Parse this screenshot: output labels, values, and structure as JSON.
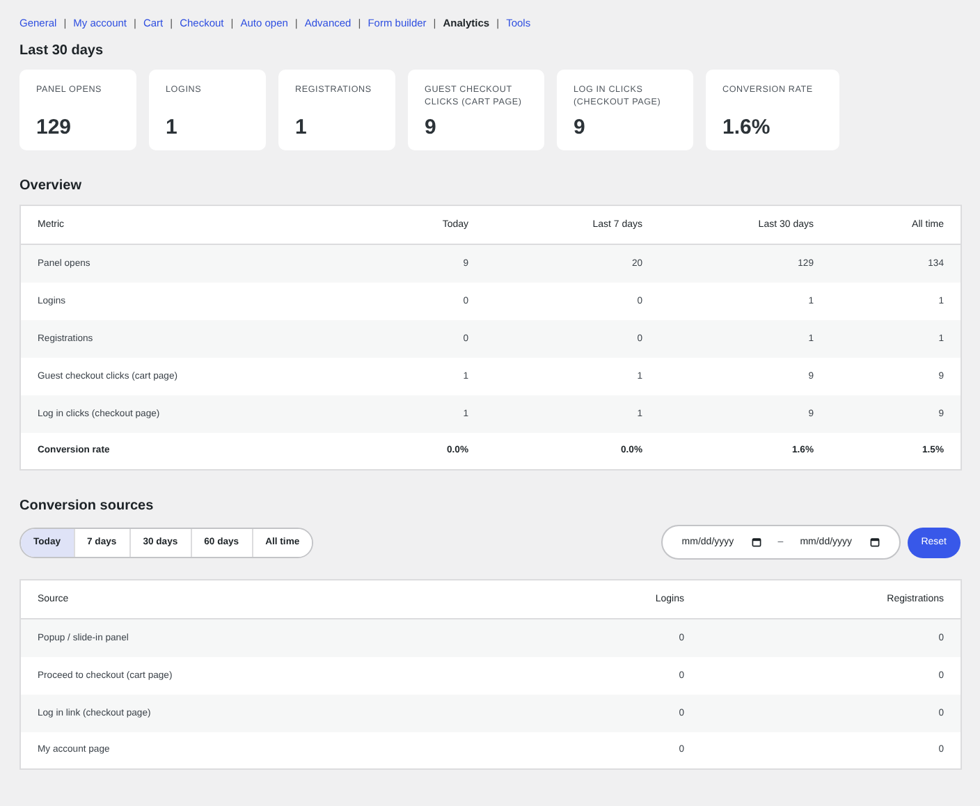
{
  "nav": [
    {
      "label": "General",
      "selected": false
    },
    {
      "separator": "|",
      "label": "My account",
      "selected": false
    },
    {
      "separator": "|",
      "label": "Cart",
      "selected": false
    },
    {
      "separator": "|",
      "label": "Checkout",
      "selected": false
    },
    {
      "separator": "|",
      "label": "Auto open",
      "selected": false
    },
    {
      "separator": "|",
      "label": "Advanced",
      "selected": false
    },
    {
      "separator": "|",
      "label": "Form builder",
      "selected": false
    },
    {
      "separator": "|",
      "label": "Analytics",
      "selected": true
    },
    {
      "separator": "|",
      "label": "Tools",
      "selected": false
    }
  ],
  "summary": {
    "title": "Last 30 days",
    "cards": [
      {
        "label": "PANEL OPENS",
        "value": "129"
      },
      {
        "label": "LOGINS",
        "value": "1"
      },
      {
        "label": "REGISTRATIONS",
        "value": "1"
      },
      {
        "label": "GUEST CHECKOUT CLICKS (CART PAGE)",
        "value": "9"
      },
      {
        "label": "LOG IN CLICKS (CHECKOUT PAGE)",
        "value": "9"
      },
      {
        "label": "CONVERSION RATE",
        "value": "1.6%"
      }
    ]
  },
  "overview": {
    "title": "Overview",
    "columns": [
      "Metric",
      "Today",
      "Last 7 days",
      "Last 30 days",
      "All time"
    ],
    "rows": [
      {
        "cells": [
          "Panel opens",
          "9",
          "20",
          "129",
          "134"
        ],
        "bold": false
      },
      {
        "cells": [
          "Logins",
          "0",
          "0",
          "1",
          "1"
        ],
        "bold": false
      },
      {
        "cells": [
          "Registrations",
          "0",
          "0",
          "1",
          "1"
        ],
        "bold": false
      },
      {
        "cells": [
          "Guest checkout clicks (cart page)",
          "1",
          "1",
          "9",
          "9"
        ],
        "bold": false
      },
      {
        "cells": [
          "Log in clicks (checkout page)",
          "1",
          "1",
          "9",
          "9"
        ],
        "bold": false
      },
      {
        "cells": [
          "Conversion rate",
          "0.0%",
          "0.0%",
          "1.6%",
          "1.5%"
        ],
        "bold": true
      }
    ]
  },
  "sources": {
    "title": "Conversion sources",
    "ranges": [
      {
        "label": "Today",
        "selected": true
      },
      {
        "label": "7 days",
        "selected": false
      },
      {
        "label": "30 days",
        "selected": false
      },
      {
        "label": "60 days",
        "selected": false
      },
      {
        "label": "All time",
        "selected": false
      }
    ],
    "date_range": {
      "start_placeholder": "mm/dd/yyyy",
      "separator": "–",
      "end_placeholder": "mm/dd/yyyy"
    },
    "reset_button": "Reset",
    "columns": [
      "Source",
      "Logins",
      "Registrations"
    ],
    "rows": [
      {
        "cells": [
          "Popup / slide-in panel",
          "0",
          "0"
        ]
      },
      {
        "cells": [
          "Proceed to checkout (cart page)",
          "0",
          "0"
        ]
      },
      {
        "cells": [
          "Log in link (checkout page)",
          "0",
          "0"
        ]
      },
      {
        "cells": [
          "My account page",
          "0",
          "0"
        ]
      }
    ]
  }
}
